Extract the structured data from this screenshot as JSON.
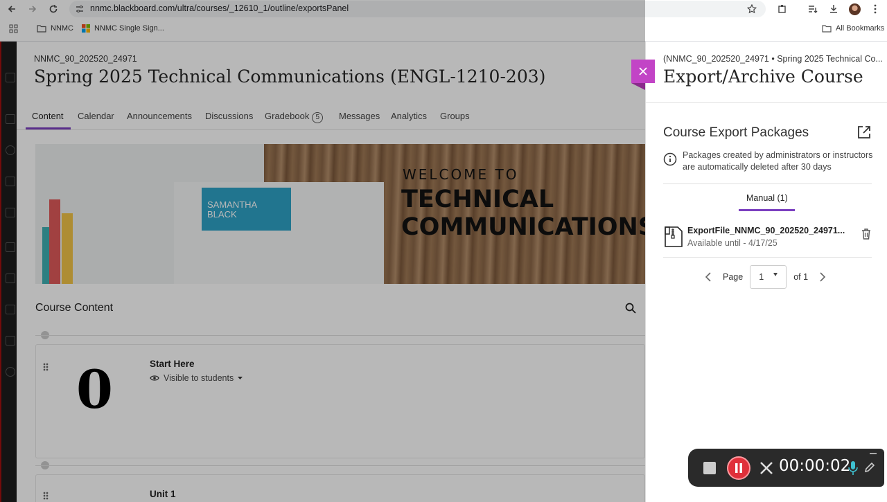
{
  "browser": {
    "url": "nnmc.blackboard.com/ultra/courses/_12610_1/outline/exportsPanel",
    "bookmarks": [
      "NNMC",
      "NNMC Single Sign..."
    ],
    "all_bookmarks": "All Bookmarks"
  },
  "course": {
    "code": "NNMC_90_202520_24971",
    "title": "Spring 2025 Technical Communications (ENGL-1210-203)",
    "tabs": [
      {
        "label": "Content"
      },
      {
        "label": "Calendar"
      },
      {
        "label": "Announcements"
      },
      {
        "label": "Discussions"
      },
      {
        "label": "Gradebook",
        "badge": "5"
      },
      {
        "label": "Messages"
      },
      {
        "label": "Analytics"
      },
      {
        "label": "Groups"
      }
    ],
    "banner": {
      "welcome": "WELCOME TO",
      "line1": "TECHNICAL",
      "line2": "COMMUNICATIONS",
      "name_card": "SAMANTHA BLACK"
    },
    "content_title": "Course Content",
    "items": [
      {
        "title": "Start Here",
        "visibility": "Visible to students",
        "big_glyph": "0"
      },
      {
        "title": "Unit 1"
      }
    ]
  },
  "panel": {
    "breadcrumb": "(NNMC_90_202520_24971 • Spring 2025 Technical Co...",
    "title": "Export/Archive Course",
    "section": "Course Export Packages",
    "info": "Packages created by administrators or instructors are automatically deleted after 30 days",
    "subtab": "Manual (1)",
    "file": {
      "name": "ExportFile_NNMC_90_202520_24971...",
      "available": "Available until - 4/17/25"
    },
    "pager": {
      "label": "Page",
      "current": "1",
      "of": "of 1"
    }
  },
  "recorder": {
    "time": "00:00:02"
  },
  "colors": {
    "accent": "#7b3fc0",
    "close": "#c244c6",
    "record": "#e0303a"
  }
}
